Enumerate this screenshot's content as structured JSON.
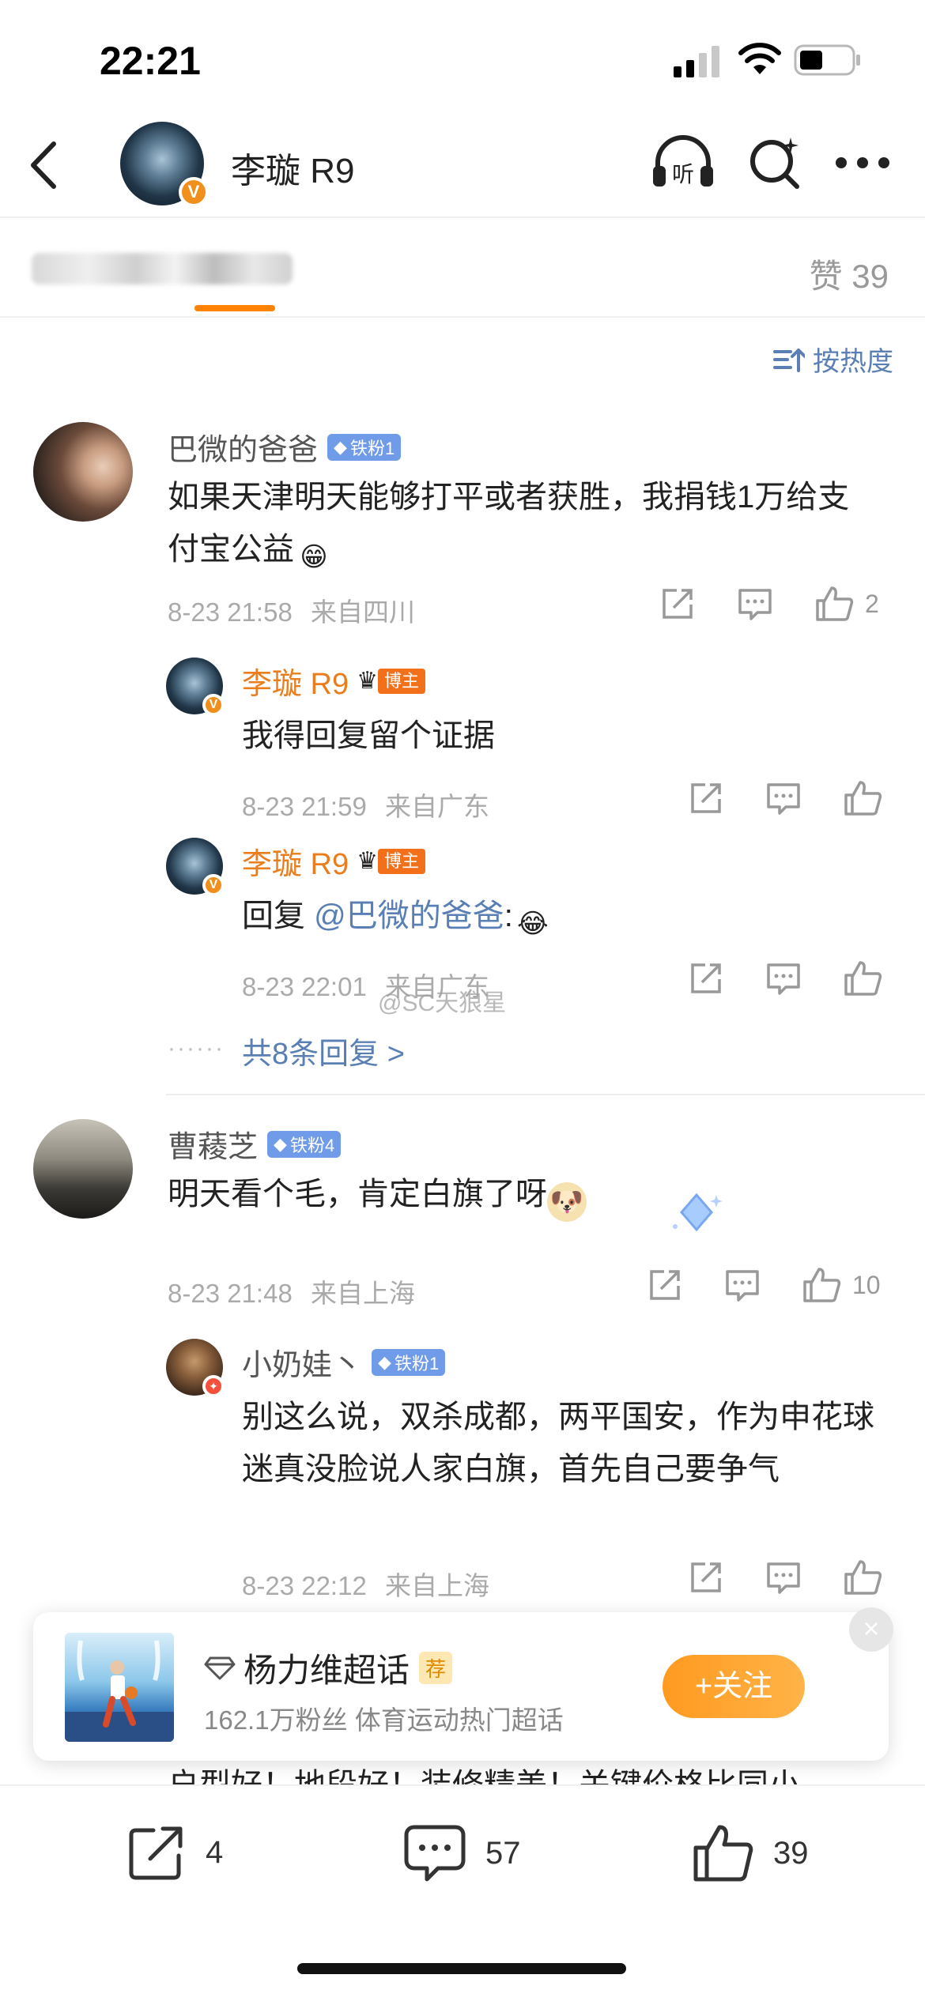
{
  "status": {
    "time": "22:21"
  },
  "nav": {
    "title": "李璇 R9",
    "listen_label": "听"
  },
  "tabs": {
    "likes": "赞 39"
  },
  "sort": {
    "label": "按热度"
  },
  "comments": [
    {
      "user": "巴微的爸爸",
      "badge": "铁粉1",
      "text": "如果天津明天能够打平或者获胜，我捐钱1万给支付宝公益",
      "emoji": "😁",
      "time": "8-23 21:58",
      "loc": "来自四川",
      "likes": "2",
      "replies": [
        {
          "user": "李璇 R9",
          "badge": "博主",
          "text": "我得回复留个证据",
          "time": "8-23 21:59",
          "loc": "来自广东"
        },
        {
          "user": "李璇 R9",
          "badge": "博主",
          "text_prefix": "回复",
          "mention": "@巴微的爸爸",
          "text_suffix": ":",
          "emoji": "😂",
          "time": "8-23 22:01",
          "loc": "来自广东"
        }
      ],
      "more": "共8条回复 >"
    },
    {
      "user": "曹薐芝",
      "badge": "铁粉4",
      "text": "明天看个毛，肯定白旗了呀",
      "emoji": "🐶",
      "time": "8-23 21:48",
      "loc": "来自上海",
      "likes": "10",
      "replies": [
        {
          "user": "小奶娃丶",
          "badge": "铁粉1",
          "text": "别这么说，双杀成都，两平国安，作为申花球迷真没脸说人家白旗，首先自己要争气",
          "time": "8-23 22:12",
          "loc": "来自上海"
        }
      ]
    }
  ],
  "watermark": "@SC天狼星",
  "banner": {
    "title": "杨力维超话",
    "tag": "荐",
    "subtitle": "162.1万粉丝 体育运动热门超话",
    "follow": "+关注"
  },
  "partial_text": "户型好！地段好！装修精美！关键价格比同小",
  "bottom": {
    "reposts": "4",
    "comments": "57",
    "likes": "39"
  },
  "colors": {
    "accent": "#ff8200",
    "link": "#5a7fb5",
    "host": "#ea7d1c"
  }
}
